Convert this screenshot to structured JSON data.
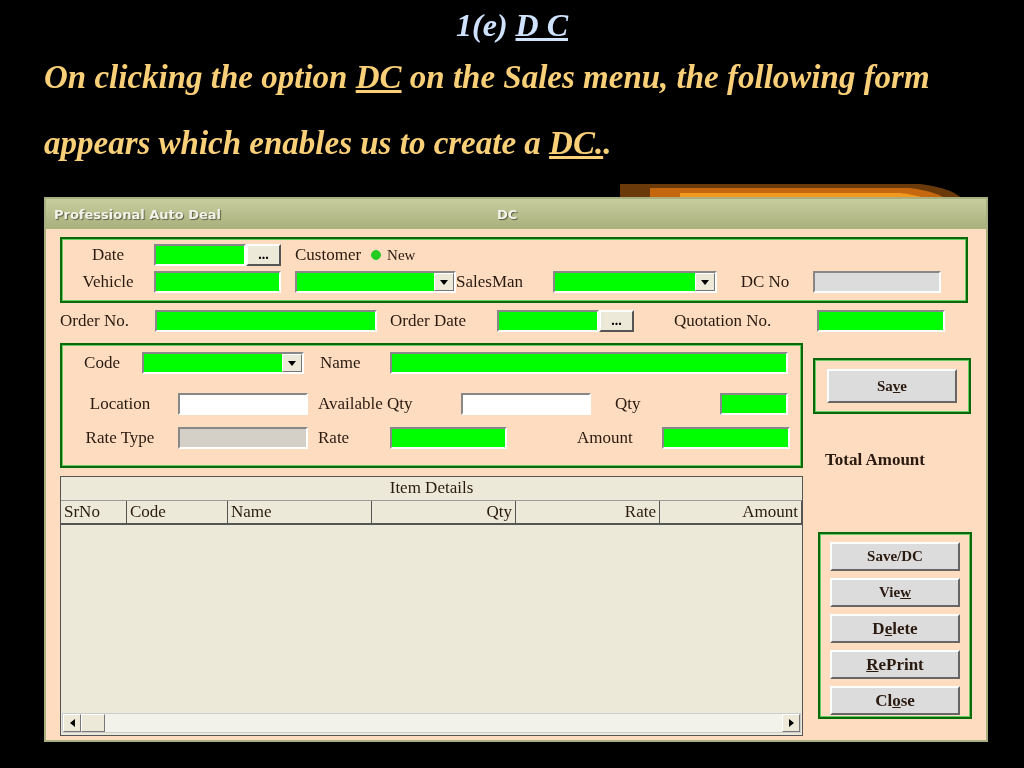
{
  "slide": {
    "title": [
      {
        "text": "1(e) ",
        "underlined": false
      },
      {
        "text": "D C",
        "underlined": true
      }
    ],
    "paragraph": [
      {
        "text": "On clicking the option ",
        "underlined": false
      },
      {
        "text": "DC",
        "underlined": true
      },
      {
        "text": " on the Sales menu, the following form appears which enables us to create a ",
        "underlined": false
      },
      {
        "text": "DC.",
        "underlined": true
      },
      {
        "text": ".",
        "underlined": false
      }
    ]
  },
  "window": {
    "title": "Professional Auto Deal",
    "caption": "DC"
  },
  "top_group": {
    "date": {
      "label": "Date",
      "color": "#00ff00",
      "picker": "..."
    },
    "customer": {
      "label": "Customer",
      "option": "New",
      "selected": true
    },
    "vehicle": {
      "label": "Vehicle",
      "color": "#00ff00",
      "combo": {
        "color": "#00ff00"
      }
    },
    "salesman": {
      "label": "SalesMan",
      "color": "#00ff00"
    },
    "dc_no": {
      "label": "DC No",
      "color": "#dcdcdc"
    }
  },
  "order_row": {
    "order_no": {
      "label": "Order No.",
      "color": "#00ff00"
    },
    "order_date": {
      "label": "Order Date",
      "color": "#00ff00",
      "picker": "..."
    },
    "quotation_no": {
      "label": "Quotation No.",
      "color": "#00ff00"
    }
  },
  "item_group": {
    "code": {
      "label": "Code",
      "color": "#00ff00"
    },
    "name": {
      "label": "Name",
      "color": "#00ff00"
    },
    "location": {
      "label": "Location",
      "color": "#ffffff"
    },
    "available_qty": {
      "label": "Available Qty",
      "color": "#ffffff"
    },
    "qty": {
      "label": "Qty",
      "color": "#00ff00"
    },
    "rate_type": {
      "label": "Rate Type",
      "color": "#d4d0c8"
    },
    "rate": {
      "label": "Rate",
      "color": "#00ff00"
    },
    "amount": {
      "label": "Amount",
      "color": "#00ff00"
    }
  },
  "save_button": {
    "before": "Sa",
    "mnemonic": "v",
    "after": "e"
  },
  "total_amount": "Total Amount",
  "table": {
    "title": "Item Details",
    "columns": [
      "SrNo",
      "Code",
      "Name",
      "Qty",
      "Rate",
      "Amount"
    ]
  },
  "actions": [
    {
      "before": "Save/DC"
    },
    {
      "before": "Vie",
      "mnemonic": "w"
    },
    {
      "before": "D",
      "mnemonic": "e",
      "after": "lete"
    },
    {
      "mnemonic": "R",
      "after": "ePrint"
    },
    {
      "before": "Cl",
      "mnemonic": "o",
      "after": "se"
    }
  ]
}
